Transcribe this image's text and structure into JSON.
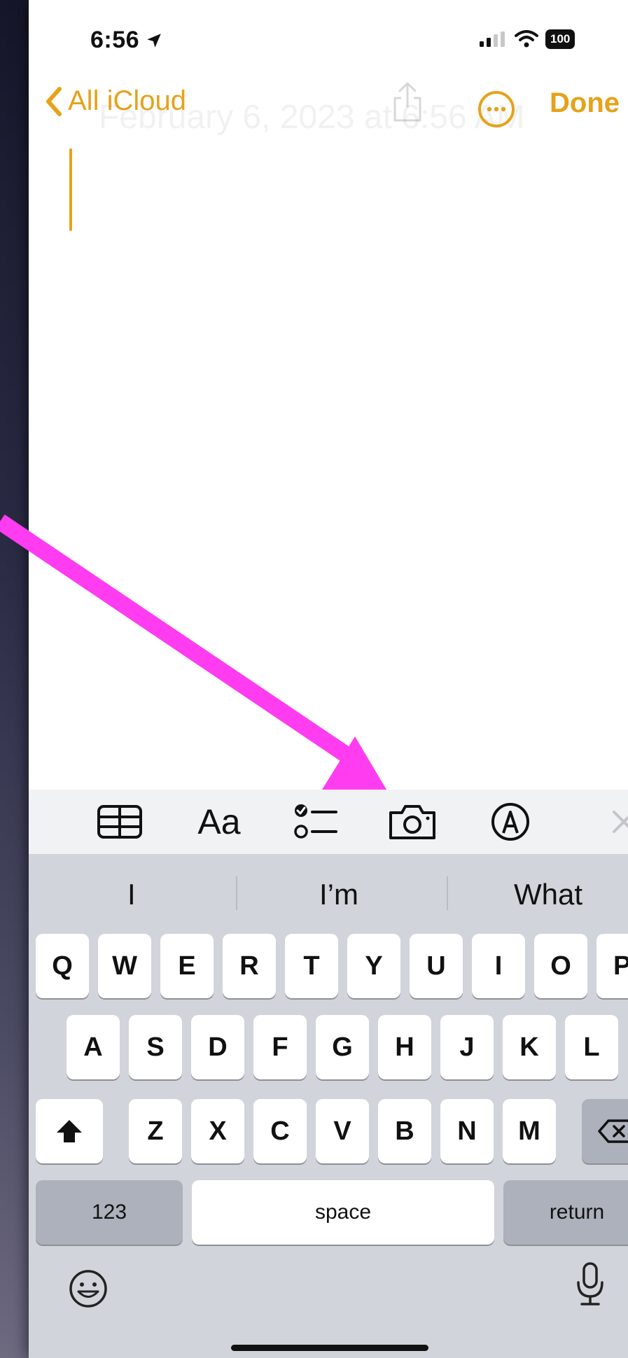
{
  "status_bar": {
    "time": "6:56",
    "battery": "100"
  },
  "nav": {
    "back_label": "All iCloud",
    "done_label": "Done",
    "note_date": "February 6, 2023 at 6:56 AM"
  },
  "toolbar": {
    "items": [
      "table-icon",
      "Aa",
      "checklist-icon",
      "camera-icon",
      "markup-icon",
      "close-icon"
    ],
    "format_label": "Aa"
  },
  "keyboard": {
    "suggestions": [
      "I",
      "I’m",
      "What"
    ],
    "row1": [
      "Q",
      "W",
      "E",
      "R",
      "T",
      "Y",
      "U",
      "I",
      "O",
      "P"
    ],
    "row2": [
      "A",
      "S",
      "D",
      "F",
      "G",
      "H",
      "J",
      "K",
      "L"
    ],
    "row3": [
      "Z",
      "X",
      "C",
      "V",
      "B",
      "N",
      "M"
    ],
    "numbers_label": "123",
    "space_label": "space",
    "return_label": "return"
  },
  "colors": {
    "accent": "#e6a21a",
    "arrow": "#ff3cf0",
    "keyboard_bg": "#d1d4da"
  }
}
